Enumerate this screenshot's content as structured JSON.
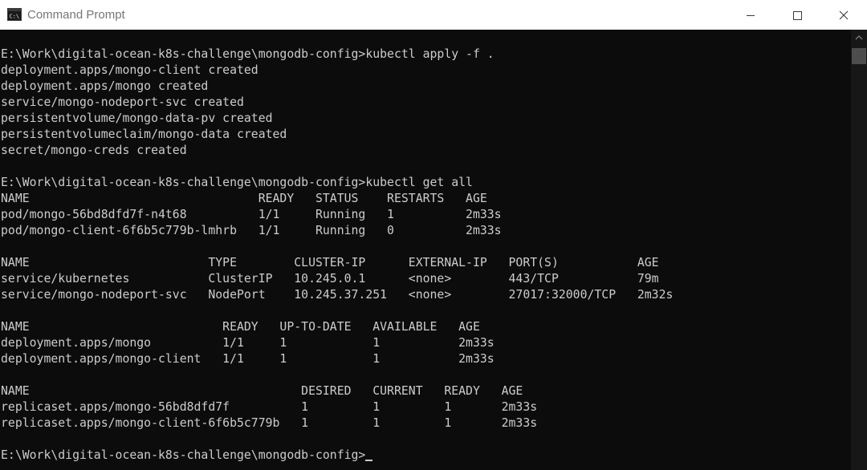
{
  "window": {
    "title": "Command Prompt",
    "app_icon": "cmd-icon",
    "controls": {
      "minimize": "minimize-icon",
      "maximize": "maximize-icon",
      "close": "close-icon"
    }
  },
  "terminal": {
    "lines": [
      "E:\\Work\\digital-ocean-k8s-challenge\\mongodb-config>kubectl apply -f .",
      "deployment.apps/mongo-client created",
      "deployment.apps/mongo created",
      "service/mongo-nodeport-svc created",
      "persistentvolume/mongo-data-pv created",
      "persistentvolumeclaim/mongo-data created",
      "secret/mongo-creds created",
      "",
      "E:\\Work\\digital-ocean-k8s-challenge\\mongodb-config>kubectl get all",
      "NAME                                READY   STATUS    RESTARTS   AGE",
      "pod/mongo-56bd8dfd7f-n4t68          1/1     Running   1          2m33s",
      "pod/mongo-client-6f6b5c779b-lmhrb   1/1     Running   0          2m33s",
      "",
      "NAME                         TYPE        CLUSTER-IP      EXTERNAL-IP   PORT(S)           AGE",
      "service/kubernetes           ClusterIP   10.245.0.1      <none>        443/TCP           79m",
      "service/mongo-nodeport-svc   NodePort    10.245.37.251   <none>        27017:32000/TCP   2m32s",
      "",
      "NAME                           READY   UP-TO-DATE   AVAILABLE   AGE",
      "deployment.apps/mongo          1/1     1            1           2m33s",
      "deployment.apps/mongo-client   1/1     1            1           2m33s",
      "",
      "NAME                                      DESIRED   CURRENT   READY   AGE",
      "replicaset.apps/mongo-56bd8dfd7f          1         1         1       2m33s",
      "replicaset.apps/mongo-client-6f6b5c779b   1         1         1       2m33s",
      "",
      "E:\\Work\\digital-ocean-k8s-challenge\\mongodb-config>"
    ]
  },
  "colors": {
    "terminal_background": "#0c0c0c",
    "terminal_text": "#cccccc",
    "titlebar_background": "#ffffff",
    "titlebar_text": "#767676"
  }
}
